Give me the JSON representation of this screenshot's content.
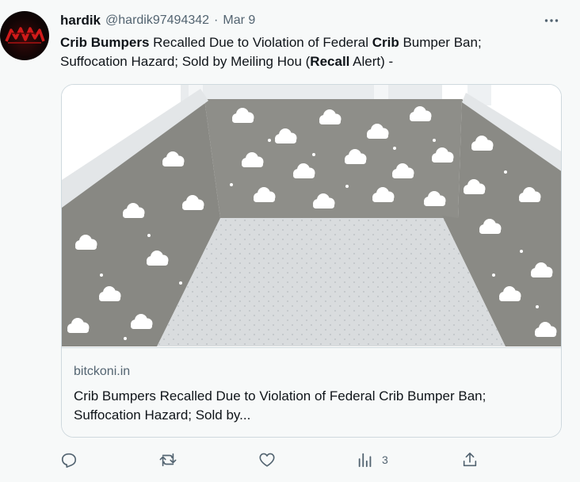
{
  "tweet": {
    "display_name": "hardik",
    "handle": "@hardik97494342",
    "separator": "·",
    "timestamp": "Mar 9",
    "text_parts": [
      {
        "text": "Crib Bumpers",
        "bold": true
      },
      {
        "text": " Recalled Due to Violation of Federal ",
        "bold": false
      },
      {
        "text": "Crib",
        "bold": true
      },
      {
        "text": " Bumper Ban; Suffocation Hazard; Sold by Meiling Hou (",
        "bold": false
      },
      {
        "text": "Recall",
        "bold": true
      },
      {
        "text": " Alert) -",
        "bold": false
      }
    ],
    "avatar_icon": "nvs-logo-icon",
    "more_icon": "more-horizontal-icon"
  },
  "card": {
    "domain": "bitckoni.in",
    "title": "Crib Bumpers Recalled Due to Violation of Federal Crib Bumper Ban; Suffocation Hazard; Sold by..."
  },
  "actions": {
    "reply_icon": "reply-icon",
    "retweet_icon": "retweet-icon",
    "like_icon": "heart-icon",
    "views_icon": "views-chart-icon",
    "views_count": "3",
    "share_icon": "share-icon"
  },
  "colors": {
    "text_primary": "#0f1419",
    "text_secondary": "#536471",
    "border": "#cfd9de",
    "background": "#f7f9f9",
    "bumper_gray": "#8e8e89",
    "cloud_white": "#ffffff"
  }
}
